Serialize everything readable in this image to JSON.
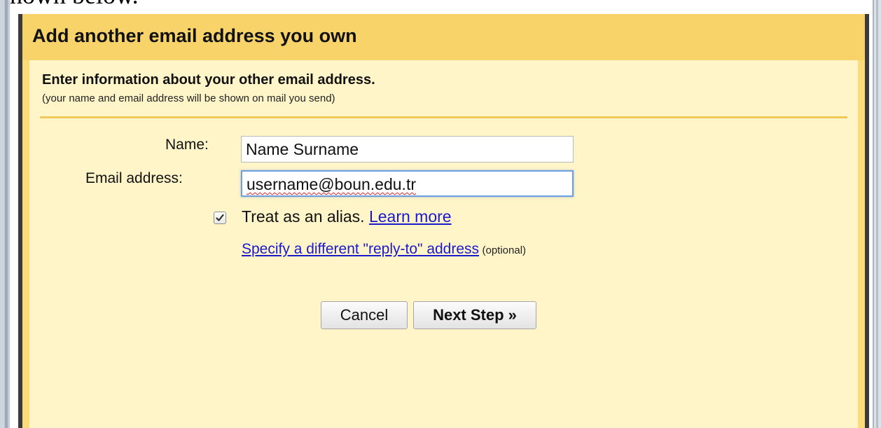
{
  "background": {
    "caption": "shown below."
  },
  "dialog": {
    "title": "Add another email address you own",
    "heading": "Enter information about your other email address.",
    "subheading": "(your name and email address will be shown on mail you send)",
    "name_label": "Name:",
    "name_value": "Name Surname",
    "email_label": "Email address:",
    "email_value": "username@boun.edu.tr",
    "alias_checked": true,
    "alias_label": "Treat as an alias.",
    "learn_more_link": "Learn more",
    "replyto_link": "Specify a different \"reply-to\" address",
    "optional_note": "(optional)",
    "cancel_button": "Cancel",
    "next_button": "Next Step »"
  },
  "colors": {
    "titlebar": "#f8d36a",
    "body": "#fff5c8",
    "divider": "#f4c95a",
    "link": "#1a1acc"
  },
  "icons": {
    "checkbox": "checkmark-icon"
  }
}
